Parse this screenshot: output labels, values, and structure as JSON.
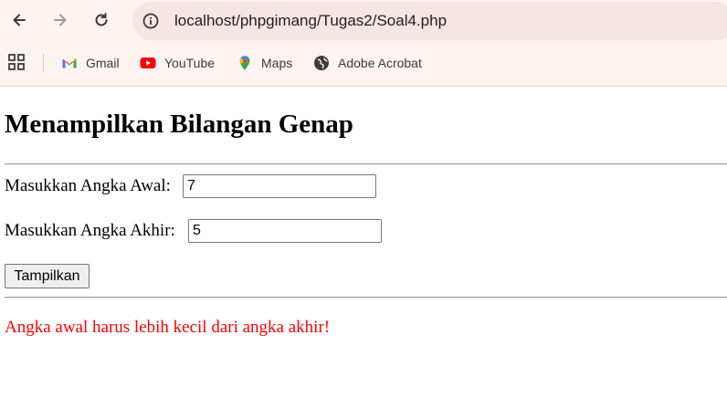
{
  "browser": {
    "url": "localhost/phpgimang/Tugas2/Soal4.php",
    "bookmarks": [
      {
        "label": "Gmail",
        "icon": "gmail-icon"
      },
      {
        "label": "YouTube",
        "icon": "youtube-icon"
      },
      {
        "label": "Maps",
        "icon": "maps-icon"
      },
      {
        "label": "Adobe Acrobat",
        "icon": "globe-icon"
      }
    ]
  },
  "page": {
    "title": "Menampilkan Bilangan Genap",
    "start_label": "Masukkan Angka Awal:",
    "start_value": "7",
    "end_label": "Masukkan Angka Akhir:",
    "end_value": "5",
    "submit_label": "Tampilkan",
    "error_message": "Angka awal harus lebih kecil dari angka akhir!"
  },
  "colors": {
    "chrome_bg": "#fdf3f1",
    "omnibox_bg": "#f5e5e3",
    "error": "#ff0000"
  }
}
